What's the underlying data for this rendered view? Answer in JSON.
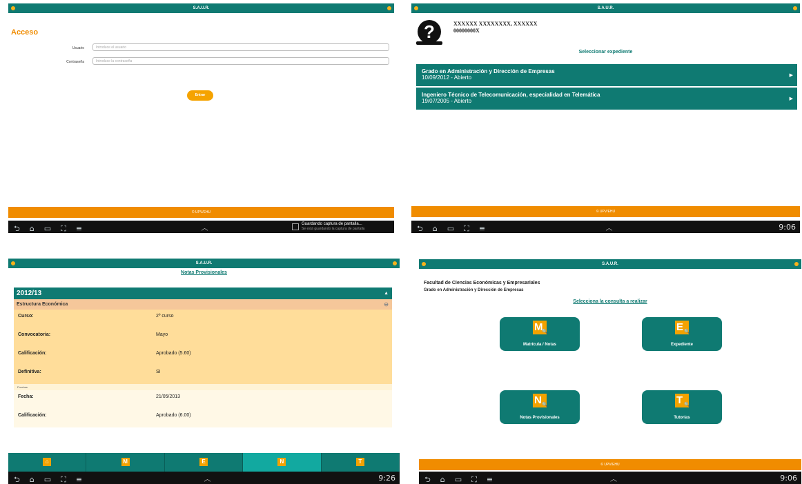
{
  "app_title": "S.A.U.R.",
  "footer_brand": "© UPV/EHU",
  "nav_icons": "⮌⌂▭⛶≡",
  "colors": {
    "primary": "#0f7a72",
    "accent": "#f08c00",
    "button": "#f5a300"
  },
  "login": {
    "heading": "Acceso",
    "user_label": "Usuario",
    "user_placeholder": "Introduce el usuario",
    "pass_label": "Contraseña",
    "pass_placeholder": "Introduce la contraseña",
    "enter_button": "Entrar",
    "notification_title": "Guardando captura de pantalla...",
    "notification_sub": "Se está guardando la captura de pantalla"
  },
  "expedientes": {
    "user_name": "XXXXXX XXXXXXXX, XXXXXX",
    "user_id": "00000000X",
    "select_title": "Seleccionar expediente",
    "items": [
      {
        "title": "Grado en Administración y Dirección de Empresas",
        "detail": "10/09/2012 - Abierto"
      },
      {
        "title": "Ingeniero Técnico de Telecomunicación, especialidad en Telemática",
        "detail": "19/07/2005 - Abierto"
      }
    ],
    "status_time": "9:06"
  },
  "notas": {
    "title": "Notas Provisionales",
    "year": "2012/13",
    "subject": "Estructura Económica",
    "rows": [
      {
        "k": "Curso:",
        "v": "2º curso"
      },
      {
        "k": "Convocatoria:",
        "v": "Mayo"
      },
      {
        "k": "Calificación:",
        "v": "Aprobado (5.60)"
      },
      {
        "k": "Definitiva:",
        "v": "SI"
      }
    ],
    "pruebas_label": "Pruebas",
    "prueba_rows": [
      {
        "k": "Fecha:",
        "v": "21/05/2013"
      },
      {
        "k": "Calificación:",
        "v": "Aprobado (6.00)"
      }
    ],
    "tabs": [
      {
        "name": "home",
        "letter": "⌂"
      },
      {
        "name": "matricula",
        "letter": "M"
      },
      {
        "name": "expediente",
        "letter": "E"
      },
      {
        "name": "notas",
        "letter": "N"
      },
      {
        "name": "tutorias",
        "letter": "T"
      }
    ],
    "status_time": "9:26"
  },
  "consulta": {
    "faculty": "Facultad de Ciencias Económicas y Empresariales",
    "degree": "Grado en Administración y Dirección de Empresas",
    "select_title": "Selecciona la consulta a realizar",
    "tiles": [
      {
        "letter": "M",
        "label": "Matrícula / Notas"
      },
      {
        "letter": "E",
        "label": "Expediente"
      },
      {
        "letter": "N",
        "label": "Notas Provisionales"
      },
      {
        "letter": "T",
        "label": "Tutorías"
      }
    ],
    "status_time": "9:06"
  }
}
